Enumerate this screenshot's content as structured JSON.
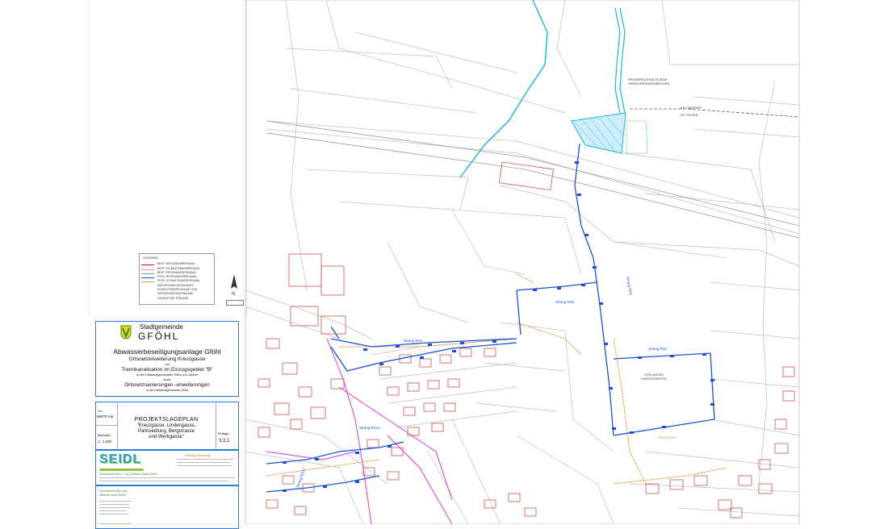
{
  "legend": {
    "title": "LEGENDE",
    "rows": [
      {
        "label": "BEST. MISCHWASSERKANAL",
        "color": "#c06"
      },
      {
        "label": "BEST. SCHMUTZWASSERKANAL",
        "color": "#d89"
      },
      {
        "label": "BEST. REGENWASSERKANAL",
        "color": "#59c"
      },
      {
        "label": "PROJ. REGENWASSERKANAL",
        "color": "#1b4fd6"
      },
      {
        "label": "PROJ. SCHMUTZWASSERKANAL",
        "color": "#e0a040"
      },
      {
        "label": "NATURSTAND GEGEKAERT",
        "color": "#888"
      },
      {
        "label": "SCHACHTBEZEICHNUNG VON",
        "color": "#888"
      },
      {
        "label": "NATURSTANDSAUFNAHME",
        "color": "#888"
      },
      {
        "label": "ZUKÜNFTIGE STRASSE",
        "color": "#888"
      }
    ]
  },
  "north": {
    "label": "N"
  },
  "titleblock": {
    "municipality_prefix": "Stadtgemeinde",
    "municipality": "GFÖHL",
    "project_title": "Abwasserbeseitigungsanlage Gföhl",
    "subtitle1": "Ortsnetzerweiterung Kreuzgasse",
    "und1": "und",
    "subtitle2": "Trennkanalisation im Einzugsgebiet \"B\"",
    "subtitle2_note": "in den Katastralgemeinden Gföhl und Jaidhof",
    "sowie": "sowie",
    "subtitle3": "Ortsnetzsanierungen -erweiterungen",
    "subtitle3_note": "in der Katastralgemeinde Gföhl",
    "gz_label": "Gz.:",
    "gz_value": "9807P.Ala",
    "scale_label": "Maßstab:",
    "scale_value": "1 : 1.000",
    "plan_title": "PROJEKTSLAGEPLAN",
    "plan_sub1": "\"Kreuzgasse, Lindengasse,",
    "plan_sub2": "Parksiedlung, Bergstrasse",
    "plan_sub3": "und Werkgasse\"",
    "einlage_label": "Einlage:",
    "einlage_value": "3.3.1",
    "company": "SEIDL",
    "company_desc": "Planung / Beratung",
    "company_detail": "Technisches Büro - Ing. Wilhelm Seidl GmbH",
    "firm_footer": "Technisches Büro Ing. Wilhelm Seidl GmbH"
  },
  "map_labels": {
    "retention": "REGENRÜCKHALTE-BZW. VERSICKERUNGSBECKEN",
    "kindergarten": "GEPLANTER KINDERGARTEN",
    "kg_jaidhof": "KG \"JAIDHOF\"",
    "kg_gfoehl": "KG \"GFÖHL\"",
    "strang_rs2": "Strang RS2",
    "strang_rs3": "Strang RS3",
    "strang_rs1": "Strang RS1",
    "strang_rs4": "Strang RS4",
    "strang_rs12": "Strang RS12",
    "strang_sd1": "Strang SD1",
    "strang_rs11": "Strang RS11"
  }
}
